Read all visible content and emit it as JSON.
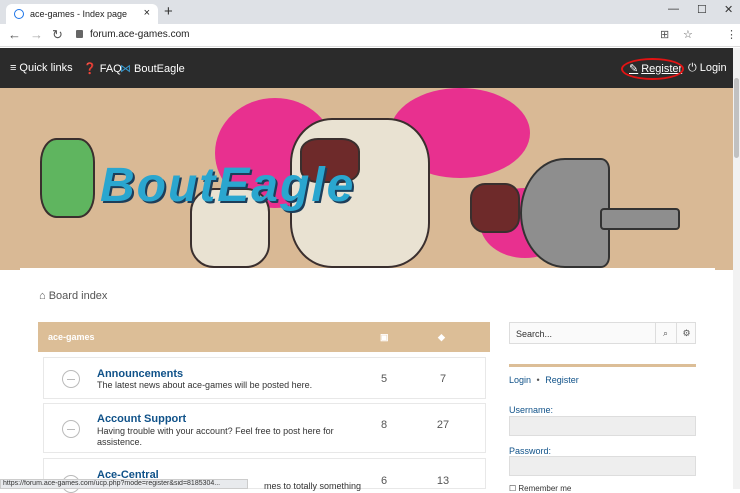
{
  "browser": {
    "tab_title": "ace-games - Index page",
    "tab_close": "×",
    "new_tab": "+",
    "url": "forum.ace-games.com",
    "status_url": "https://forum.ace-games.com/ucp.php?mode=register&sid=8185304..."
  },
  "navbar": {
    "quick_links": "Quick links",
    "faq": "FAQ",
    "bouteagle": "BoutEagle",
    "register": "Register",
    "login": "Login"
  },
  "banner": {
    "logo_text": "BoutEagle"
  },
  "breadcrumb": "Board index",
  "forum": {
    "category": "ace-games",
    "rows": [
      {
        "name": "Announcements",
        "desc": "The latest news about ace-games will be posted here.",
        "topics": "5",
        "posts": "7"
      },
      {
        "name": "Account Support",
        "desc": "Having trouble with your account? Feel free to post here for assistence.",
        "topics": "8",
        "posts": "27"
      },
      {
        "name": "Ace-Central",
        "desc": "mes to totally something",
        "topics": "6",
        "posts": "13"
      }
    ]
  },
  "sidebar": {
    "search_placeholder": "Search...",
    "login_link": "Login",
    "separator": "•",
    "register_link": "Register",
    "username_label": "Username:",
    "password_label": "Password:",
    "remember_me": "Remember me"
  },
  "colors": {
    "accent": "#dcbe97",
    "navbar": "#2b2b2b",
    "link": "#105289",
    "highlight_ring": "#e21313"
  }
}
